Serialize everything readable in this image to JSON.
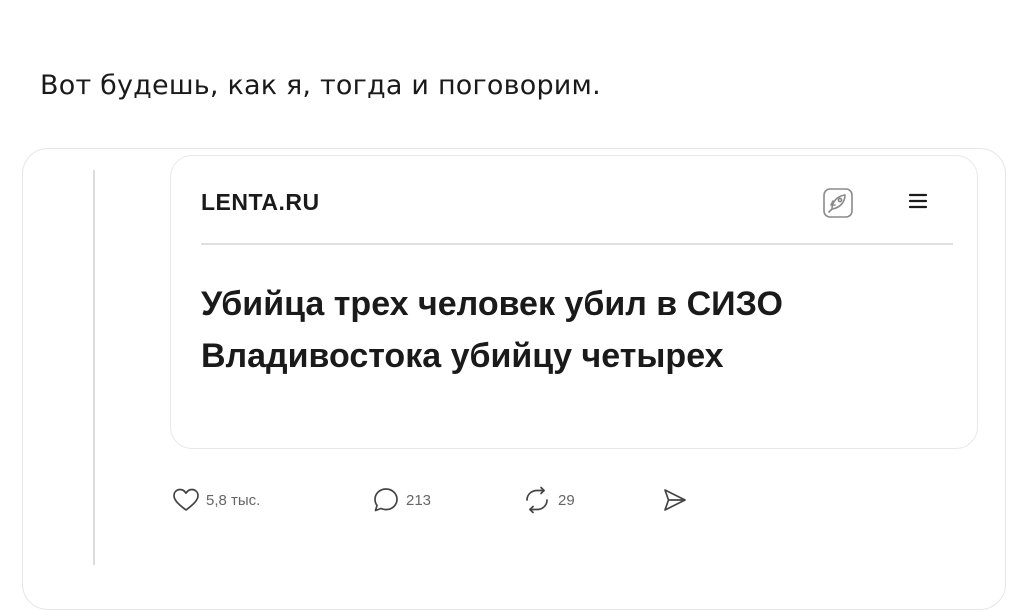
{
  "post": {
    "caption": "Вот будешь, как я, тогда и поговорим."
  },
  "embed": {
    "site_logo": "LENTA.RU",
    "headline": "Убийца трех человек убил в СИЗО Владивостока убийцу четырех",
    "icons": {
      "share": "rocket-icon",
      "menu": "menu-icon"
    }
  },
  "actions": {
    "likes": "5,8 тыс.",
    "replies": "213",
    "reposts": "29",
    "icons": [
      "heart-icon",
      "comment-icon",
      "repost-icon",
      "send-icon"
    ]
  }
}
